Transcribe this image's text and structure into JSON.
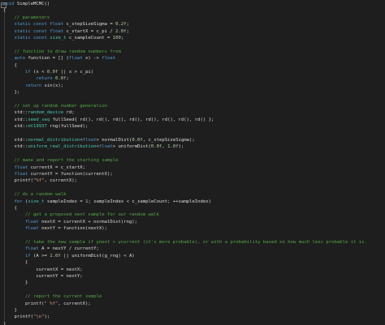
{
  "editor": {
    "theme_colors": {
      "background": "#1e1e1e",
      "keyword": "#569cd6",
      "type": "#4ec9b0",
      "comment": "#57a64a",
      "number": "#b5cea8",
      "string": "#d69d85",
      "plain": "#dcdcdc"
    },
    "fold_glyph": "−",
    "lines": [
      [
        {
          "t": "void",
          "c": "kw"
        },
        {
          "t": " SimpleMCMC()",
          "c": "plain"
        }
      ],
      [
        {
          "t": "{",
          "c": "plain"
        }
      ],
      [
        {
          "t": "    // parameters",
          "c": "com"
        }
      ],
      [
        {
          "t": "    static const float",
          "c": "kw"
        },
        {
          "t": " c_stepSizeSigma = ",
          "c": "plain"
        },
        {
          "t": "0.2f",
          "c": "num"
        },
        {
          "t": ";",
          "c": "plain"
        }
      ],
      [
        {
          "t": "    static const float",
          "c": "kw"
        },
        {
          "t": " c_startX = c_pi / ",
          "c": "plain"
        },
        {
          "t": "2.0f",
          "c": "num"
        },
        {
          "t": ";",
          "c": "plain"
        }
      ],
      [
        {
          "t": "    static const ",
          "c": "kw"
        },
        {
          "t": "size_t",
          "c": "typ"
        },
        {
          "t": " c_sampleCount = ",
          "c": "plain"
        },
        {
          "t": "100",
          "c": "num"
        },
        {
          "t": ";",
          "c": "plain"
        }
      ],
      [],
      [
        {
          "t": "    // function to draw random numbers from",
          "c": "com"
        }
      ],
      [
        {
          "t": "    auto",
          "c": "kw"
        },
        {
          "t": " function = [] (",
          "c": "plain"
        },
        {
          "t": "float",
          "c": "kw"
        },
        {
          "t": " x) -> ",
          "c": "plain"
        },
        {
          "t": "float",
          "c": "kw"
        }
      ],
      [
        {
          "t": "    {",
          "c": "plain"
        }
      ],
      [
        {
          "t": "        if",
          "c": "kw"
        },
        {
          "t": " (x < ",
          "c": "plain"
        },
        {
          "t": "0.0f",
          "c": "num"
        },
        {
          "t": " || x > c_pi)",
          "c": "plain"
        }
      ],
      [
        {
          "t": "            return",
          "c": "kw"
        },
        {
          "t": " ",
          "c": "plain"
        },
        {
          "t": "0.0f",
          "c": "num"
        },
        {
          "t": ";",
          "c": "plain"
        }
      ],
      [
        {
          "t": "        return",
          "c": "kw"
        },
        {
          "t": " sin(x);",
          "c": "plain"
        }
      ],
      [
        {
          "t": "    };",
          "c": "plain"
        }
      ],
      [],
      [
        {
          "t": "    // set up random number generation",
          "c": "com"
        }
      ],
      [
        {
          "t": "    std::",
          "c": "plain"
        },
        {
          "t": "random_device",
          "c": "typ"
        },
        {
          "t": " rd;",
          "c": "plain"
        }
      ],
      [
        {
          "t": "    std::",
          "c": "plain"
        },
        {
          "t": "seed_seq",
          "c": "typ"
        },
        {
          "t": " fullSeed{ rd(), rd(), rd(), rd(), rd(), rd(), rd(), rd() };",
          "c": "plain"
        }
      ],
      [
        {
          "t": "    std::",
          "c": "plain"
        },
        {
          "t": "mt19937",
          "c": "typ"
        },
        {
          "t": " rng(fullSeed);",
          "c": "plain"
        }
      ],
      [],
      [
        {
          "t": "    std::",
          "c": "plain"
        },
        {
          "t": "normal_distribution",
          "c": "typ"
        },
        {
          "t": "<",
          "c": "plain"
        },
        {
          "t": "float",
          "c": "kw"
        },
        {
          "t": "> normalDist(",
          "c": "plain"
        },
        {
          "t": "0.0f",
          "c": "num"
        },
        {
          "t": ", c_stepSizeSigma);",
          "c": "plain"
        }
      ],
      [
        {
          "t": "    std::",
          "c": "plain"
        },
        {
          "t": "uniform_real_distribution",
          "c": "typ"
        },
        {
          "t": "<",
          "c": "plain"
        },
        {
          "t": "float",
          "c": "kw"
        },
        {
          "t": "> uniformDist(",
          "c": "plain"
        },
        {
          "t": "0.0f",
          "c": "num"
        },
        {
          "t": ", ",
          "c": "plain"
        },
        {
          "t": "1.0f",
          "c": "num"
        },
        {
          "t": ");",
          "c": "plain"
        }
      ],
      [],
      [
        {
          "t": "    // make and report the starting sample",
          "c": "com"
        }
      ],
      [
        {
          "t": "    float",
          "c": "kw"
        },
        {
          "t": " currentX = c_startX;",
          "c": "plain"
        }
      ],
      [
        {
          "t": "    float",
          "c": "kw"
        },
        {
          "t": " currentY = function(currentX);",
          "c": "plain"
        }
      ],
      [
        {
          "t": "    printf(",
          "c": "plain"
        },
        {
          "t": "\"%f\"",
          "c": "str"
        },
        {
          "t": ", currentX);",
          "c": "plain"
        }
      ],
      [],
      [
        {
          "t": "    // do a random walk",
          "c": "com"
        }
      ],
      [
        {
          "t": "    for",
          "c": "kw"
        },
        {
          "t": " (",
          "c": "plain"
        },
        {
          "t": "size_t",
          "c": "typ"
        },
        {
          "t": " sampleIndex = ",
          "c": "plain"
        },
        {
          "t": "1",
          "c": "num"
        },
        {
          "t": "; sampleIndex < c_sampleCount; ++sampleIndex)",
          "c": "plain"
        }
      ],
      [
        {
          "t": "    {",
          "c": "plain"
        }
      ],
      [
        {
          "t": "        // get a proposed next sample for our random walk",
          "c": "com"
        }
      ],
      [
        {
          "t": "        float",
          "c": "kw"
        },
        {
          "t": " nextX = currentX + normalDist(rng);",
          "c": "plain"
        }
      ],
      [
        {
          "t": "        float",
          "c": "kw"
        },
        {
          "t": " nextY = function(nextX);",
          "c": "plain"
        }
      ],
      [],
      [
        {
          "t": "        // take the new sample if ynext > ycurrent (it's more probable), or with a probability based on how much less probable it is.",
          "c": "com"
        }
      ],
      [
        {
          "t": "        float",
          "c": "kw"
        },
        {
          "t": " A = nextY / currentY;",
          "c": "plain"
        }
      ],
      [
        {
          "t": "        if",
          "c": "kw"
        },
        {
          "t": " (A >= ",
          "c": "plain"
        },
        {
          "t": "1.0f",
          "c": "num"
        },
        {
          "t": " || uniformDist(g_rng) < A)",
          "c": "plain"
        }
      ],
      [
        {
          "t": "        {",
          "c": "plain"
        }
      ],
      [
        {
          "t": "            currentX = nextX;",
          "c": "plain"
        }
      ],
      [
        {
          "t": "            currentY = nextY;",
          "c": "plain"
        }
      ],
      [
        {
          "t": "        }",
          "c": "plain"
        }
      ],
      [],
      [
        {
          "t": "        // report the current sample",
          "c": "com"
        }
      ],
      [
        {
          "t": "        printf(",
          "c": "plain"
        },
        {
          "t": "\" %f\"",
          "c": "str"
        },
        {
          "t": ", currentX);",
          "c": "plain"
        }
      ],
      [
        {
          "t": "    }",
          "c": "plain"
        }
      ],
      [
        {
          "t": "    printf(",
          "c": "plain"
        },
        {
          "t": "\"\\n\"",
          "c": "str"
        },
        {
          "t": ");",
          "c": "plain"
        }
      ],
      [
        {
          "t": "}",
          "c": "plain"
        }
      ]
    ]
  }
}
